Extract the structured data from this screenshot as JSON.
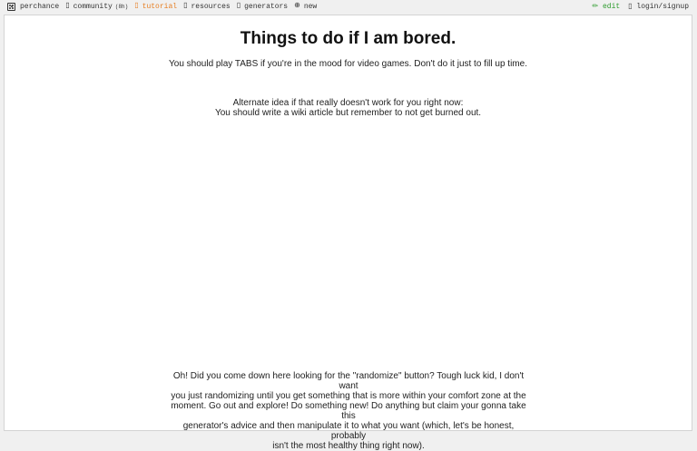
{
  "nav": {
    "brand": "perchance",
    "community": "community",
    "community_count": "(8h)",
    "tutorial": "tutorial",
    "resources": "resources",
    "generators": "generators",
    "new": "new",
    "edit": "edit",
    "login": "login/signup",
    "tutorial_color": "#e67e22",
    "edit_color": "#2e9c2e"
  },
  "content": {
    "title": "Things to do if I am bored.",
    "suggestion": "You should play TABS if you're in the mood for video games. Don't do it just to fill up time.",
    "alternate_line1": "Alternate idea if that really doesn't work for you right now:",
    "alternate_line2": "You should write a wiki article but remember to not get burned out.",
    "bottom_line1": "Oh! Did you come down here looking for the \"randomize\" button? Tough luck kid, I don't want",
    "bottom_line2": "you just randomizing until you get something that is more within your comfort zone at the",
    "bottom_line3": "moment. Go out and explore! Do something new! Do anything but claim your gonna take this",
    "bottom_line4": "generator's advice and then manipulate it to what you want (which, let's be honest, probably",
    "bottom_line5": "isn't the most healthy thing right now)."
  }
}
